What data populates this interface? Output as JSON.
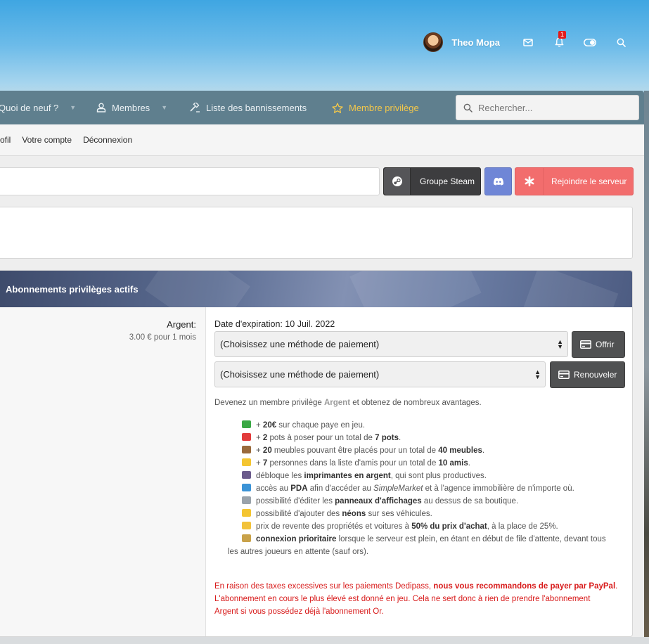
{
  "header": {
    "username": "Theo Mopa",
    "notification_count": "1",
    "icons": [
      "avatar",
      "mail-icon",
      "bell-icon",
      "theme-toggle-icon",
      "search-icon"
    ]
  },
  "nav": {
    "items": [
      {
        "label": "Quoi de neuf ?",
        "has_caret": true
      },
      {
        "label": "Membres",
        "icon": "user-icon",
        "has_caret": true
      },
      {
        "label": "Liste des bannissements",
        "icon": "gavel-icon"
      },
      {
        "label": "Membre privilège",
        "icon": "star-icon"
      }
    ],
    "search_placeholder": "Rechercher..."
  },
  "subnav": {
    "items": [
      "ofil",
      "Votre compte",
      "Déconnexion"
    ]
  },
  "buttons": {
    "steam": "Groupe Steam",
    "join": "Rejoindre le serveur"
  },
  "panel": {
    "title": "Abonnements privilèges actifs",
    "tier_name": "Argent:",
    "tier_price": "3.00 € pour 1 mois",
    "expiry": "Date d'expiration: 10 Juil. 2022",
    "payment_placeholder": "(Choisissez une méthode de paiement)",
    "offer_label": "Offrir",
    "renew_label": "Renouveler",
    "intro_pre": "Devenez un membre privilège ",
    "intro_tier": "Argent",
    "intro_post": " et obtenez de nombreux avantages."
  },
  "perks": [
    {
      "icon": "money-icon",
      "color": "#3aa845",
      "parts": [
        [
          "",
          "+ "
        ],
        [
          "b",
          "20€"
        ],
        [
          "",
          " sur chaque paye en jeu."
        ]
      ]
    },
    {
      "icon": "mushroom-icon",
      "color": "#e23b3b",
      "parts": [
        [
          "",
          "+ "
        ],
        [
          "b",
          "2"
        ],
        [
          "",
          " pots à poser pour un total de "
        ],
        [
          "b",
          "7 pots"
        ],
        [
          "",
          "."
        ]
      ]
    },
    {
      "icon": "chair-icon",
      "color": "#9a6a3c",
      "parts": [
        [
          "",
          "+ "
        ],
        [
          "b",
          "20"
        ],
        [
          "",
          " meubles pouvant être placés pour un total de "
        ],
        [
          "b",
          "40 meubles"
        ],
        [
          "",
          "."
        ]
      ]
    },
    {
      "icon": "sparkles-icon",
      "color": "#f4c531",
      "parts": [
        [
          "",
          "+ "
        ],
        [
          "b",
          "7"
        ],
        [
          "",
          " personnes dans la liste d'amis pour un total de "
        ],
        [
          "b",
          "10 amis"
        ],
        [
          "",
          "."
        ]
      ]
    },
    {
      "icon": "printer-icon",
      "color": "#6b5b8c",
      "parts": [
        [
          "",
          "débloque les "
        ],
        [
          "b",
          "imprimantes en argent"
        ],
        [
          "",
          ", qui sont plus productives."
        ]
      ]
    },
    {
      "icon": "computer-icon",
      "color": "#3b93d6",
      "parts": [
        [
          "",
          "accès au "
        ],
        [
          "b",
          "PDA"
        ],
        [
          "",
          " afin d'accéder au "
        ],
        [
          "i",
          "SimpleMarket"
        ],
        [
          "",
          " et à l'agence immobilière de n'importe où."
        ]
      ]
    },
    {
      "icon": "cart-icon",
      "color": "#9aa3ab",
      "parts": [
        [
          "",
          "possibilité d'éditer les "
        ],
        [
          "b",
          "panneaux d'affichages"
        ],
        [
          "",
          " au dessus de sa boutique."
        ]
      ]
    },
    {
      "icon": "star-icon",
      "color": "#f4c531",
      "parts": [
        [
          "",
          "possibilité d'ajouter des "
        ],
        [
          "b",
          "néons"
        ],
        [
          "",
          " sur ses véhicules."
        ]
      ]
    },
    {
      "icon": "tag-icon",
      "color": "#f2c23a",
      "parts": [
        [
          "",
          "prix de revente des propriétés et voitures à "
        ],
        [
          "b",
          "50% du prix d'achat"
        ],
        [
          "",
          ", à la place de 25%."
        ]
      ]
    },
    {
      "icon": "hourglass-icon",
      "color": "#c9a24a",
      "parts": [
        [
          "b",
          "connexion prioritaire"
        ],
        [
          "",
          " lorsque le serveur est plein, en étant en début de file d'attente, devant tous"
        ]
      ]
    }
  ],
  "perks_wrap": "les autres joueurs en attente (sauf ors).",
  "notice": {
    "line1_pre": "En raison des taxes excessives sur les paiements Dedipass, ",
    "line1_bold": "nous vous recommandons de payer par PayPal",
    "line1_post": ".",
    "line2": "L'abonnement en cours le plus élevé est donné en jeu. Cela ne sert donc à rien de prendre l'abonnement",
    "line3": "Argent si vous possédez déjà l'abonnement Or."
  }
}
